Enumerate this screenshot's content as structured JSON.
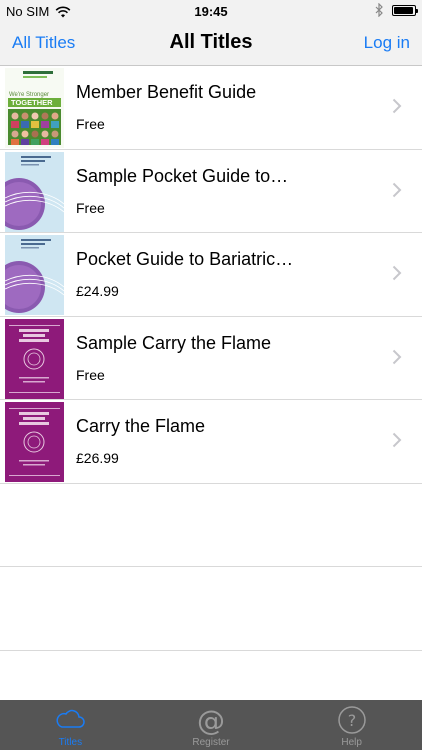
{
  "status_bar": {
    "carrier": "No SIM",
    "time": "19:45",
    "battery_level": 0.95
  },
  "nav_bar": {
    "left_button": "All Titles",
    "title": "All Titles",
    "right_button": "Log in"
  },
  "titles": [
    {
      "name": "Member Benefit Guide",
      "price": "Free",
      "cover": "member-guide"
    },
    {
      "name": "Sample Pocket Guide to…",
      "price": "Free",
      "cover": "pocket-guide"
    },
    {
      "name": "Pocket Guide to Bariatric…",
      "price": "£24.99",
      "cover": "pocket-guide"
    },
    {
      "name": "Sample Carry the Flame",
      "price": "Free",
      "cover": "carry-flame"
    },
    {
      "name": "Carry the Flame",
      "price": "£26.99",
      "cover": "carry-flame"
    }
  ],
  "tab_bar": {
    "tabs": [
      {
        "label": "Titles",
        "icon": "cloud-icon",
        "active": true
      },
      {
        "label": "Register",
        "icon": "at-icon",
        "active": false
      },
      {
        "label": "Help",
        "icon": "help-icon",
        "active": false
      }
    ]
  },
  "colors": {
    "accent": "#1a7cf4",
    "tab_bar_bg": "#555555",
    "nav_bg": "#f2f2f2",
    "carry_flame_cover": "#8e1a7a",
    "pocket_guide_cover": "#cfe6f2"
  }
}
